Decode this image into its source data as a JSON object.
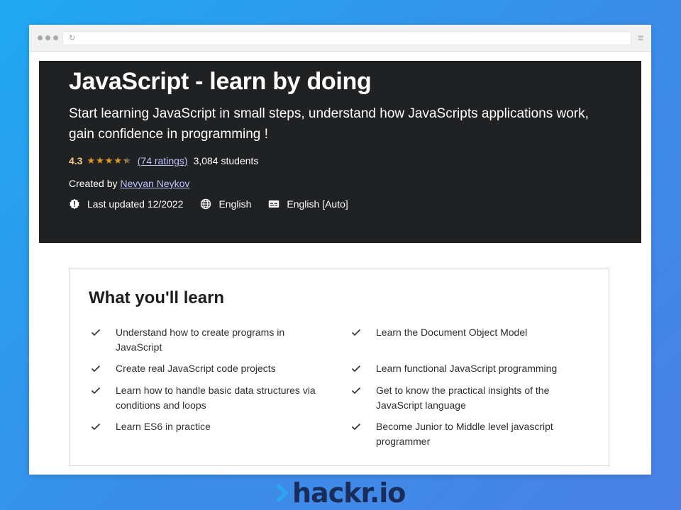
{
  "browser": {
    "icons": {
      "reload": "reload-icon",
      "menu": "hamburger-menu-icon"
    }
  },
  "hero": {
    "title": "JavaScript - learn by doing",
    "subtitle": "Start learning JavaScript in small steps, understand how JavaScripts applications work, gain confidence in programming !",
    "rating": "4.3",
    "stars": 4.3,
    "ratings_count": "(74 ratings)",
    "students": "3,084 students",
    "created_by_label": "Created by",
    "author": "Nevyan Neykov",
    "last_updated": "Last updated 12/2022",
    "language": "English",
    "captions": "English [Auto]",
    "colors": {
      "background": "#1f2123",
      "star": "#e59819",
      "rating": "#f3ca8c",
      "link": "#c0c4fc"
    }
  },
  "learn": {
    "title": "What you'll learn",
    "items": [
      "Understand how to create programs in JavaScript",
      "Learn the Document Object Model",
      "Create real JavaScript code projects",
      "Learn functional JavaScript programming",
      "Learn how to handle basic data structures via conditions and loops",
      "Get to know the practical insights of the JavaScript language",
      "Learn ES6 in practice",
      "Become Junior to Middle level javascript programmer"
    ]
  },
  "brand": {
    "name": "hackr.io",
    "color": "#1a2c59"
  }
}
